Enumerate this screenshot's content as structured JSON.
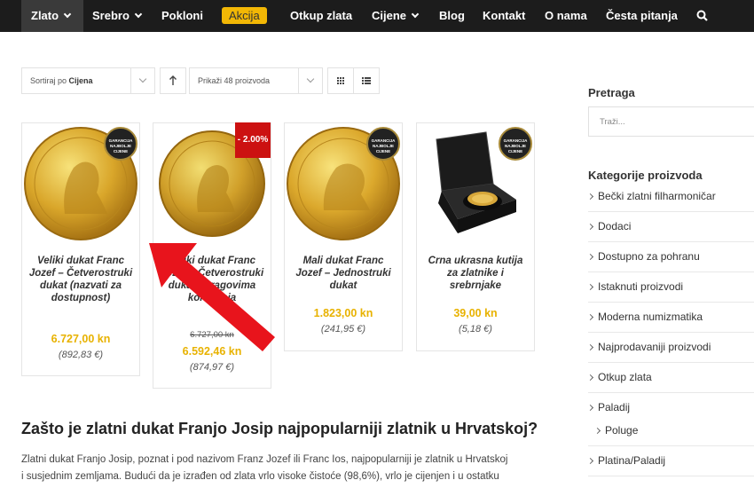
{
  "nav": {
    "items": [
      {
        "label": "Zlato",
        "has_dropdown": true,
        "active": true
      },
      {
        "label": "Srebro",
        "has_dropdown": true,
        "active": false
      },
      {
        "label": "Pokloni",
        "has_dropdown": false,
        "active": false
      },
      {
        "label": "Akcija",
        "has_dropdown": false,
        "active": false,
        "highlight": true
      },
      {
        "label": "Otkup zlata",
        "has_dropdown": false,
        "active": false
      },
      {
        "label": "Cijene",
        "has_dropdown": true,
        "active": false
      },
      {
        "label": "Blog",
        "has_dropdown": false,
        "active": false
      },
      {
        "label": "Kontakt",
        "has_dropdown": false,
        "active": false
      },
      {
        "label": "O nama",
        "has_dropdown": false,
        "active": false
      },
      {
        "label": "Česta pitanja",
        "has_dropdown": false,
        "active": false
      }
    ],
    "search_icon": "search-icon"
  },
  "toolbar": {
    "sort_prefix": "Sortiraj po",
    "sort_value": "Cijena",
    "show_label": "Prikaži 48 proizvoda",
    "sort_direction_icon": "arrow-up-icon",
    "grid_icon": "grid-view-icon",
    "list_icon": "list-view-icon"
  },
  "products": [
    {
      "name": "Veliki dukat Franc Jozef – Četverostruki dukat (nazvati za dostupnost)",
      "price": "6.727,00 kn",
      "eur": "(892,83 €)",
      "badge": "GARANCIJA NAJBOLJE CIJENE"
    },
    {
      "name": "Veliki dukat Franc Jozef – Četverostruki dukat s tragovima korištenja",
      "old_price": "6.727,00 kn",
      "price": "6.592,46 kn",
      "eur": "(874,97 €)",
      "sale_badge": "- 2.00%"
    },
    {
      "name": "Mali dukat Franc Jozef – Jednostruki dukat",
      "price": "1.823,00 kn",
      "eur": "(241,95 €)",
      "badge": "GARANCIJA NAJBOLJE CIJENE"
    },
    {
      "name": "Crna ukrasna kutija za zlatnike i srebrnjake",
      "price": "39,00 kn",
      "eur": "(5,18 €)",
      "badge": "GARANCIJA NAJBOLJE CIJENE"
    }
  ],
  "article": {
    "heading": "Zašto je zlatni dukat Franjo Josip najpopularniji zlatnik u Hrvatskoj?",
    "line1": "Zlatni dukat Franjo Josip, poznat i pod nazivom Franz Jozef ili Franc Ios, najpopularniji je zlatnik u Hrvatskoj",
    "line2": "i susjednim zemljama. Budući da je izrađen od zlata vrlo visoke čistoće (98,6%), vrlo je cijenjen i u ostatku"
  },
  "sidebar": {
    "search_title": "Pretraga",
    "search_placeholder": "Traži...",
    "categories_title": "Kategorije proizvoda",
    "categories": [
      "Bečki zlatni filharmoničar",
      "Dodaci",
      "Dostupno za pohranu",
      "Istaknuti proizvodi",
      "Moderna numizmatika",
      "Najprodavaniji proizvodi",
      "Otkup zlata",
      "Paladij",
      "Poluge",
      "Platina/Paladij"
    ]
  },
  "colors": {
    "nav_bg": "#1c1c1c",
    "accent": "#f2b705",
    "price": "#e8b200",
    "sale": "#cc1111",
    "arrow": "#e8141c"
  }
}
